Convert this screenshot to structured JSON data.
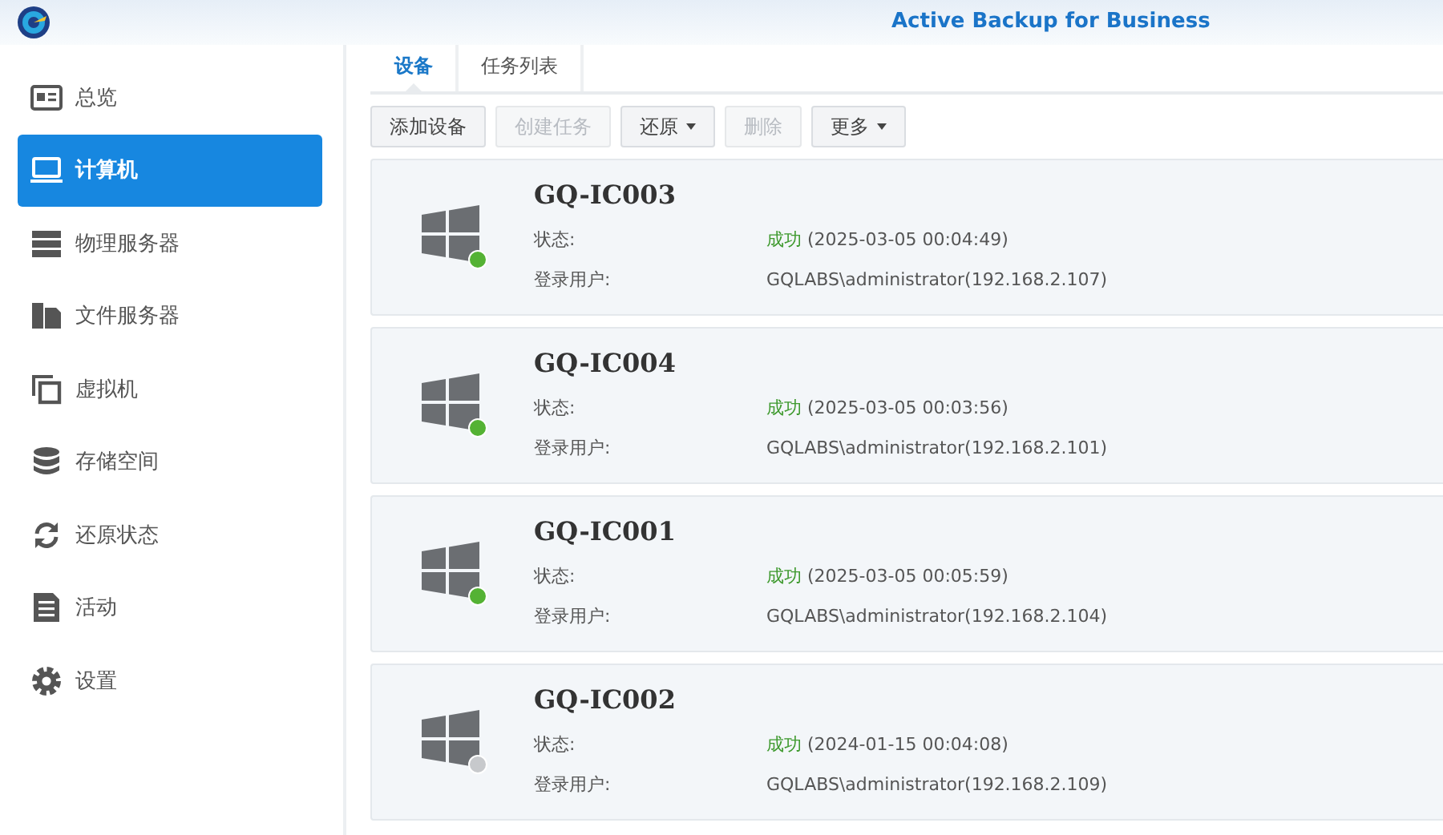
{
  "window": {
    "title": "Active Backup for Business"
  },
  "sidebar": {
    "items": [
      {
        "label": "总览",
        "selected": false
      },
      {
        "label": "计算机",
        "selected": true
      },
      {
        "label": "物理服务器",
        "selected": false
      },
      {
        "label": "文件服务器",
        "selected": false
      },
      {
        "label": "虚拟机",
        "selected": false
      },
      {
        "label": "存储空间",
        "selected": false
      },
      {
        "label": "还原状态",
        "selected": false
      },
      {
        "label": "活动",
        "selected": false
      },
      {
        "label": "设置",
        "selected": false
      }
    ]
  },
  "tabs": [
    {
      "label": "设备",
      "selected": true
    },
    {
      "label": "任务列表",
      "selected": false
    }
  ],
  "toolbar": [
    {
      "label": "添加设备",
      "disabled": false,
      "dropdown": false
    },
    {
      "label": "创建任务",
      "disabled": true,
      "dropdown": false
    },
    {
      "label": "还原",
      "disabled": false,
      "dropdown": true
    },
    {
      "label": "删除",
      "disabled": true,
      "dropdown": false
    },
    {
      "label": "更多",
      "disabled": false,
      "dropdown": true
    }
  ],
  "devices": [
    {
      "name": "GQ-IC003",
      "online": true,
      "status_label": "状态:",
      "status": "成功",
      "status_time": "(2025-03-05 00:04:49)",
      "user_label": "登录用户:",
      "user": "GQLABS\\administrator(192.168.2.107)"
    },
    {
      "name": "GQ-IC004",
      "online": true,
      "status_label": "状态:",
      "status": "成功",
      "status_time": "(2025-03-05 00:03:56)",
      "user_label": "登录用户:",
      "user": "GQLABS\\administrator(192.168.2.101)"
    },
    {
      "name": "GQ-IC001",
      "online": true,
      "status_label": "状态:",
      "status": "成功",
      "status_time": "(2025-03-05 00:05:59)",
      "user_label": "登录用户:",
      "user": "GQLABS\\administrator(192.168.2.104)"
    },
    {
      "name": "GQ-IC002",
      "online": false,
      "status_label": "状态:",
      "status": "成功",
      "status_time": "(2024-01-15 00:04:08)",
      "user_label": "登录用户:",
      "user": "GQLABS\\administrator(192.168.2.109)"
    }
  ]
}
